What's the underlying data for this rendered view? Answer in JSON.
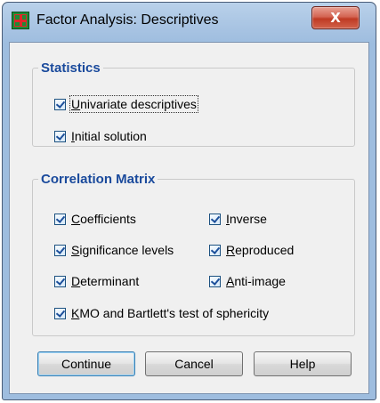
{
  "window": {
    "title": "Factor Analysis: Descriptives",
    "close_glyph": "X"
  },
  "statistics": {
    "legend": "Statistics",
    "items": [
      {
        "prefix": "",
        "mnemonic": "U",
        "rest": "nivariate descriptives",
        "checked": true
      },
      {
        "prefix": "",
        "mnemonic": "I",
        "rest": "nitial solution",
        "checked": true
      }
    ]
  },
  "correlation_matrix": {
    "legend": "Correlation Matrix",
    "items": [
      {
        "prefix": "",
        "mnemonic": "C",
        "rest": "oefficients",
        "checked": true
      },
      {
        "prefix": "",
        "mnemonic": "I",
        "rest": "nverse",
        "checked": true
      },
      {
        "prefix": "",
        "mnemonic": "S",
        "rest": "ignificance levels",
        "checked": true
      },
      {
        "prefix": "",
        "mnemonic": "R",
        "rest": "eproduced",
        "checked": true
      },
      {
        "prefix": "",
        "mnemonic": "D",
        "rest": "eterminant",
        "checked": true
      },
      {
        "prefix": "",
        "mnemonic": "A",
        "rest": "nti-image",
        "checked": true
      },
      {
        "prefix": "",
        "mnemonic": "K",
        "rest": "MO and Bartlett's test of sphericity",
        "checked": true
      }
    ]
  },
  "buttons": {
    "continue": "Continue",
    "cancel": "Cancel",
    "help": "Help"
  },
  "colors": {
    "legend_text": "#1a4a9c",
    "title_bar": "#a7c3e2",
    "close_button": "#c94a33"
  },
  "icons": {
    "app": "spss-app-icon",
    "close": "close-icon",
    "check": "checkmark-icon"
  }
}
